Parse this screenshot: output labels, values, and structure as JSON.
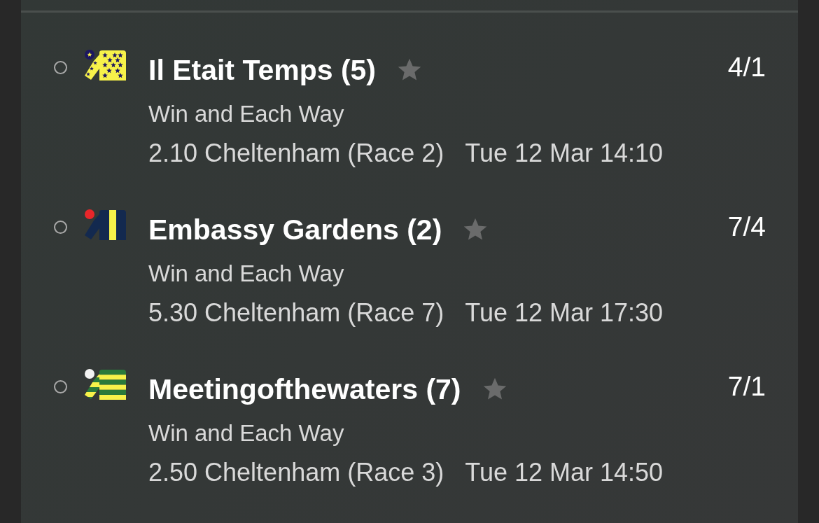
{
  "bets": [
    {
      "selected": false,
      "kind": "stars",
      "name": "Il Etait Temps (5)",
      "odds": "4/1",
      "market": "Win and Each Way",
      "race": "2.10 Cheltenham (Race 2)",
      "time": "Tue 12 Mar 14:10"
    },
    {
      "selected": false,
      "kind": "stripe",
      "name": "Embassy Gardens (2)",
      "odds": "7/4",
      "market": "Win and Each Way",
      "race": "5.30 Cheltenham (Race 7)",
      "time": "Tue 12 Mar 17:30"
    },
    {
      "selected": false,
      "kind": "hoops",
      "name": "Meetingofthewaters (7)",
      "odds": "7/1",
      "market": "Win and Each Way",
      "race": "2.50 Cheltenham (Race 3)",
      "time": "Tue 12 Mar 14:50"
    }
  ]
}
